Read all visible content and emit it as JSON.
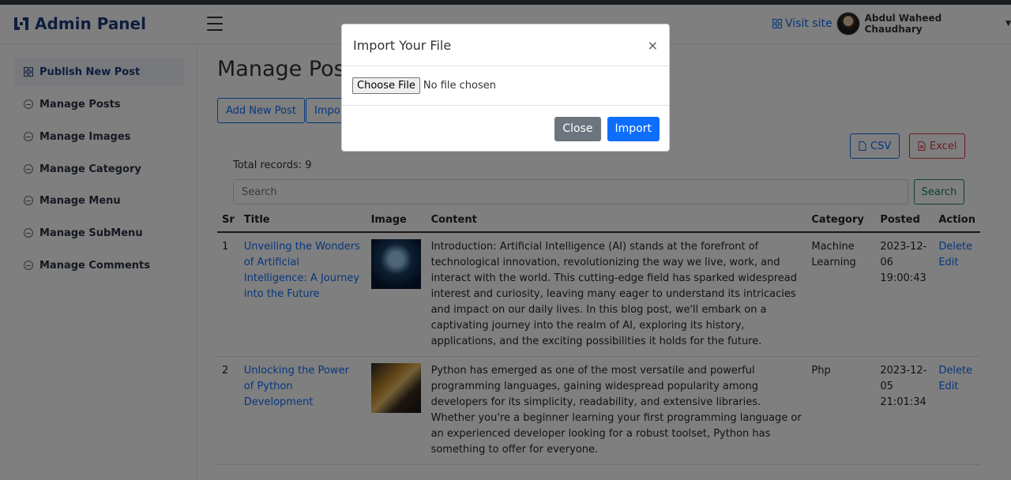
{
  "header": {
    "brand": "Admin Panel",
    "visit_site": "Visit site",
    "user_name": "Abdul Waheed Chaudhary"
  },
  "sidebar": {
    "items": [
      {
        "label": "Publish New Post"
      },
      {
        "label": "Manage Posts"
      },
      {
        "label": "Manage Images"
      },
      {
        "label": "Manage Category"
      },
      {
        "label": "Manage Menu"
      },
      {
        "label": "Manage SubMenu"
      },
      {
        "label": "Manage Comments"
      }
    ]
  },
  "main": {
    "title": "Manage Post",
    "add_button": "Add New Post",
    "import_button": "Impo",
    "csv_button": "CSV",
    "excel_button": "Excel",
    "total_records": "Total records: 9",
    "search_placeholder": "Search",
    "search_button": "Search",
    "table": {
      "headers": [
        "Sr",
        "Title",
        "Image",
        "Content",
        "Category",
        "Posted",
        "Action"
      ],
      "rows": [
        {
          "sr": "1",
          "title": "Unveiling the Wonders of Artificial Intelligence: A Journey into the Future",
          "content": "Introduction: Artificial Intelligence (AI) stands at the forefront of technological innovation, revolutionizing the way we live, work, and interact with the world. This cutting-edge field has sparked widespread interest and curiosity, leaving many eager to understand its intricacies and impact on our daily lives. In this blog post, we'll embark on a captivating journey into the realm of AI, exploring its history, applications, and the exciting possibilities it holds for the future.",
          "category": "Machine Learning",
          "posted": "2023-12-06 19:00:43",
          "delete": "Delete",
          "edit": "Edit"
        },
        {
          "sr": "2",
          "title": "Unlocking the Power of Python Development",
          "content": "Python has emerged as one of the most versatile and powerful programming languages, gaining widespread popularity among developers for its simplicity, readability, and extensive libraries. Whether you're a beginner learning your first programming language or an experienced developer looking for a robust toolset, Python has something to offer for everyone.",
          "category": "Php",
          "posted": "2023-12-05 21:01:34",
          "delete": "Delete",
          "edit": "Edit"
        }
      ]
    }
  },
  "modal": {
    "title": "Import Your File",
    "close_symbol": "×",
    "file_button": "Choose File",
    "file_status": "No file chosen",
    "close_button": "Close",
    "import_button": "Import"
  },
  "colors": {
    "primary": "#0d6efd",
    "success": "#198754",
    "danger": "#dc3545",
    "secondary": "#6c757d",
    "brand": "#1a3d7c"
  }
}
